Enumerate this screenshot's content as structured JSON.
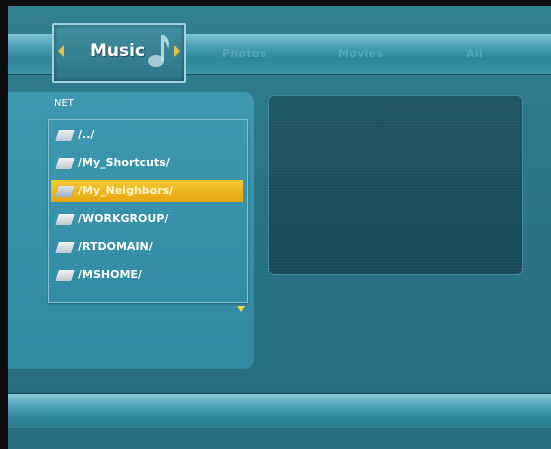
{
  "tabs": {
    "active": {
      "label": "Music"
    },
    "photos": {
      "label": "Photos"
    },
    "movies": {
      "label": "Movies"
    },
    "all": {
      "label": "All"
    }
  },
  "browser": {
    "title": "NET",
    "items": [
      {
        "label": "/../",
        "selected": false
      },
      {
        "label": "/My_Shortcuts/",
        "selected": false
      },
      {
        "label": "/My_Neighbors/",
        "selected": true
      },
      {
        "label": "/WORKGROUP/",
        "selected": false
      },
      {
        "label": "/RTDOMAIN/",
        "selected": false
      },
      {
        "label": "/MSHOME/",
        "selected": false
      }
    ]
  },
  "colors": {
    "background": "#2a7487",
    "selection": "#f0bb20",
    "preview": "#1d5161"
  },
  "icons": [
    "folder-icon",
    "music-note-icon",
    "arrow-left-icon",
    "arrow-right-icon",
    "scroll-down-icon"
  ]
}
